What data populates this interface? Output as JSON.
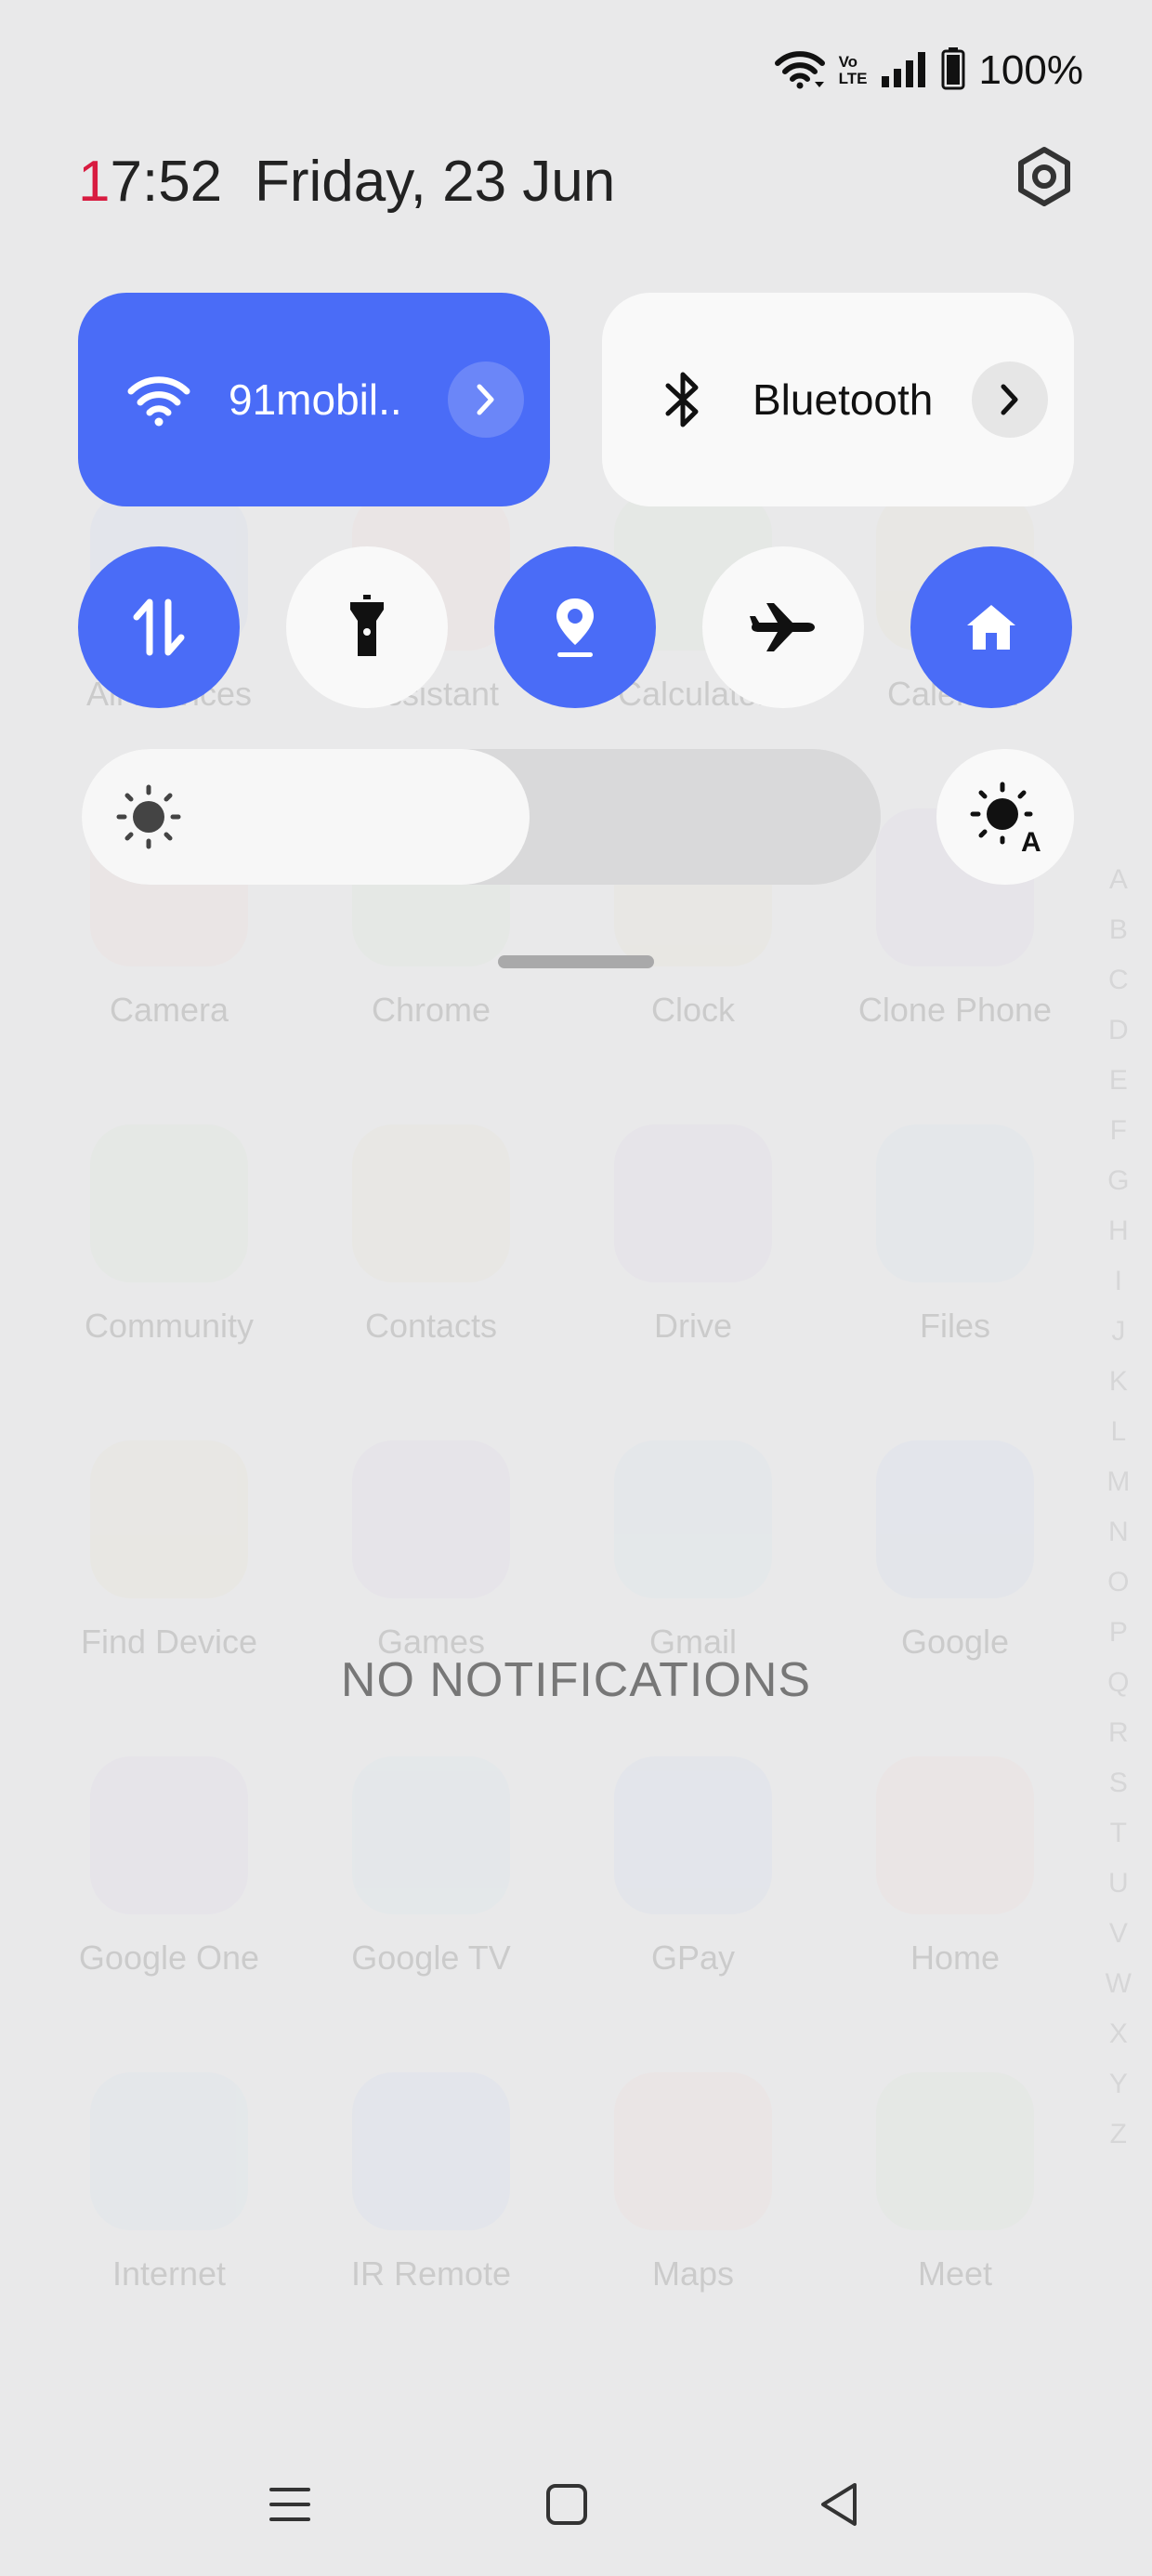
{
  "status_bar": {
    "wifi_icon": "wifi-icon",
    "volte_top": "Vo",
    "volte_bottom": "LTE",
    "signal_icon": "signal-icon",
    "battery_icon": "battery-icon",
    "battery": "100%"
  },
  "header": {
    "clock_first_digit": "1",
    "clock_rest": "7:52",
    "date": "Friday, 23 Jun",
    "settings_icon": "settings-gear-icon"
  },
  "tiles": {
    "wifi": {
      "label": "91mobil..",
      "state": "on"
    },
    "bluetooth": {
      "label": "Bluetooth",
      "state": "off"
    }
  },
  "toggles": [
    {
      "name": "mobile-data",
      "icon": "data-transfer-icon",
      "state": "on"
    },
    {
      "name": "flashlight",
      "icon": "flashlight-icon",
      "state": "off"
    },
    {
      "name": "location",
      "icon": "location-pin-icon",
      "state": "on"
    },
    {
      "name": "airplane-mode",
      "icon": "airplane-icon",
      "state": "off"
    },
    {
      "name": "home",
      "icon": "home-icon",
      "state": "on"
    }
  ],
  "brightness": {
    "level": 0.56,
    "auto_label": "A"
  },
  "notifications": {
    "empty_text": "NO NOTIFICATIONS"
  },
  "background_apps": [
    [
      "All Devices",
      "Assistant",
      "Calculator",
      "Calendar"
    ],
    [
      "Camera",
      "Chrome",
      "Clock",
      "Clone Phone"
    ],
    [
      "Community",
      "Contacts",
      "Drive",
      "Files"
    ],
    [
      "Find Device",
      "Games",
      "Gmail",
      "Google"
    ],
    [
      "Google One",
      "Google TV",
      "GPay",
      "Home"
    ],
    [
      "Internet",
      "IR Remote",
      "Maps",
      "Meet"
    ]
  ],
  "background_letters": [
    "A",
    "B",
    "C",
    "D",
    "E",
    "F",
    "G",
    "H",
    "I",
    "J",
    "K",
    "L",
    "M",
    "N",
    "O",
    "P",
    "Q",
    "R",
    "S",
    "T",
    "U",
    "V",
    "W",
    "X",
    "Y",
    "Z"
  ],
  "colors": {
    "accent": "#4a6cf7",
    "tile_off": "#f9f9f9",
    "clock_red": "#d81b40",
    "background": "#e9e9ea"
  },
  "nav_bar": {
    "menu": "menu-icon",
    "home": "square-home-icon",
    "back": "back-triangle-icon"
  }
}
